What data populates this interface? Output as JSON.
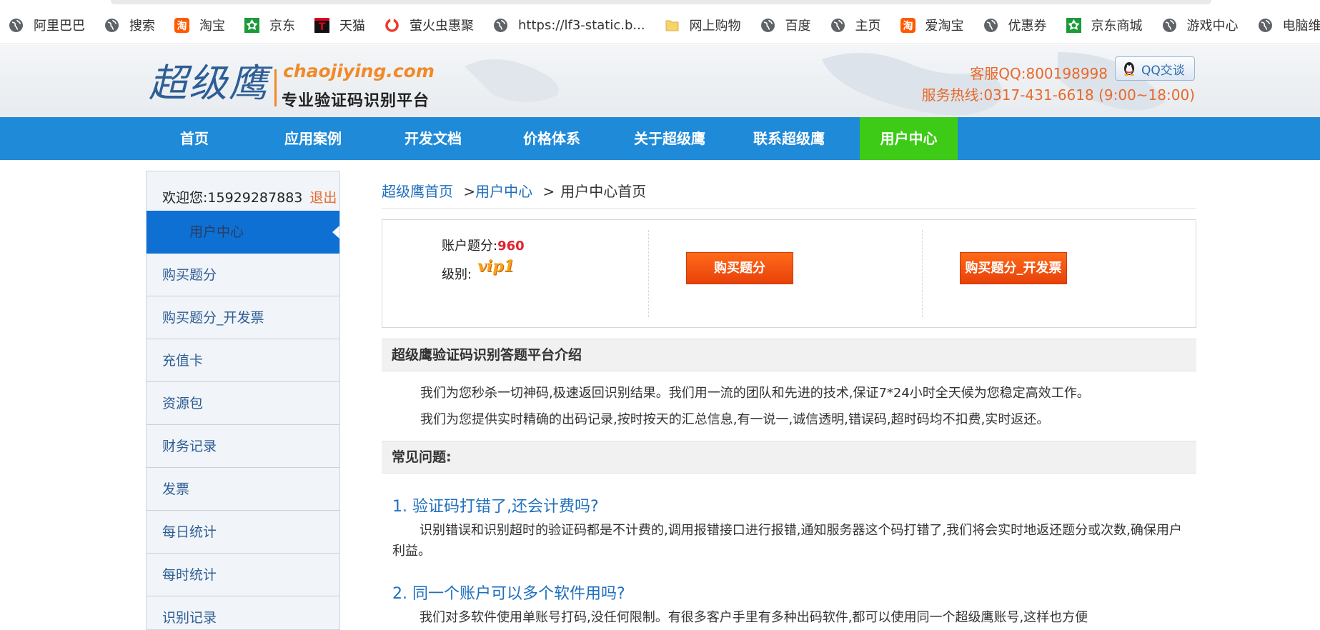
{
  "bookmarks": [
    {
      "label": "阿里巴巴",
      "icon": "globe-icon"
    },
    {
      "label": "搜索",
      "icon": "globe-icon"
    },
    {
      "label": "淘宝",
      "icon": "taobao-icon"
    },
    {
      "label": "京东",
      "icon": "jd-icon"
    },
    {
      "label": "天猫",
      "icon": "tmall-icon"
    },
    {
      "label": "萤火虫惠聚",
      "icon": "ring-icon"
    },
    {
      "label": "https://lf3-static.b...",
      "icon": "globe-icon"
    },
    {
      "label": "网上购物",
      "icon": "folder-icon"
    },
    {
      "label": "百度",
      "icon": "globe-icon"
    },
    {
      "label": "主页",
      "icon": "globe-icon"
    },
    {
      "label": "爱淘宝",
      "icon": "taobao-icon"
    },
    {
      "label": "优惠券",
      "icon": "globe-icon"
    },
    {
      "label": "京东商城",
      "icon": "jd-icon"
    },
    {
      "label": "游戏中心",
      "icon": "globe-icon"
    },
    {
      "label": "电脑维修",
      "icon": "globe-icon"
    }
  ],
  "header": {
    "logo_cn": "超级鹰",
    "logo_en": "chaojiying.com",
    "logo_sub": "专业验证码识别平台",
    "qq_label": "客服QQ:",
    "qq_number": "800198998",
    "qq_button": "QQ交谈",
    "hotline": "服务热线:0317-431-6618 (9:00~18:00)"
  },
  "nav": [
    {
      "label": "首页"
    },
    {
      "label": "应用案例"
    },
    {
      "label": "开发文档"
    },
    {
      "label": "价格体系"
    },
    {
      "label": "关于超级鹰"
    },
    {
      "label": "联系超级鹰"
    },
    {
      "label": "用户中心",
      "active": true
    }
  ],
  "sidebar": {
    "welcome": "欢迎您:15929287883",
    "logout": "退出",
    "heading": "用户中心",
    "items": [
      {
        "label": "购买题分"
      },
      {
        "label": "购买题分_开发票"
      },
      {
        "label": "充值卡"
      },
      {
        "label": "资源包"
      },
      {
        "label": "财务记录"
      },
      {
        "label": "发票"
      },
      {
        "label": "每日统计"
      },
      {
        "label": "每时统计"
      },
      {
        "label": "识别记录"
      }
    ]
  },
  "breadcrumb": {
    "home": "超级鹰首页",
    "sep1": ">",
    "center": "用户中心",
    "sep2": ">",
    "current": "用户中心首页"
  },
  "account": {
    "score_label": "账户题分:",
    "score_value": "960",
    "level_label": "级别:",
    "level_badge": "vip1",
    "buy_button": "购买题分",
    "buy_invoice_button": "购买题分_开发票"
  },
  "intro": {
    "title": "超级鹰验证码识别答题平台介绍",
    "p1": "我们为您秒杀一切神码,极速返回识别结果。我们用一流的团队和先进的技术,保证7*24小时全天候为您稳定高效工作。",
    "p2": "我们为您提供实时精确的出码记录,按时按天的汇总信息,有一说一,诚信透明,错误码,超时码均不扣费,实时返还。"
  },
  "faq": {
    "title": "常见问题:",
    "q1": "1. 验证码打错了,还会计费吗?",
    "a1": "识别错误和识别超时的验证码都是不计费的,调用报错接口进行报错,通知服务器这个码打错了,我们将会实时地返还题分或次数,确保用户利益。",
    "q2": "2. 同一个账户可以多个软件用吗?",
    "a2": "我们对多软件使用单账号打码,没任何限制。有很多客户手里有多种出码软件,都可以使用同一个超级鹰账号,这样也方便"
  },
  "colors": {
    "nav_bg": "#1f8ad8",
    "nav_active": "#3dcb18",
    "accent_orange": "#e8692a",
    "link_blue": "#1f6fbd"
  }
}
